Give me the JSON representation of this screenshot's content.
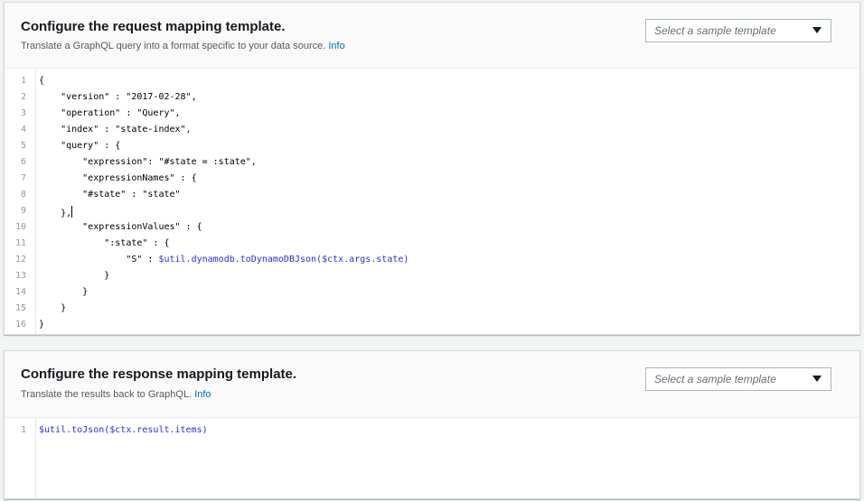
{
  "request": {
    "title": "Configure the request mapping template.",
    "description": "Translate a GraphQL query into a format specific to your data source.",
    "info_label": "Info",
    "select_placeholder": "Select a sample template",
    "lines": [
      {
        "n": "1",
        "text": "{"
      },
      {
        "n": "2",
        "text": "    \"version\" : \"2017-02-28\","
      },
      {
        "n": "3",
        "text": "    \"operation\" : \"Query\","
      },
      {
        "n": "4",
        "text": "    \"index\" : \"state-index\","
      },
      {
        "n": "5",
        "text": "    \"query\" : {"
      },
      {
        "n": "6",
        "text": "        \"expression\": \"#state = :state\","
      },
      {
        "n": "7",
        "text": "        \"expressionNames\" : {"
      },
      {
        "n": "8",
        "text": "        \"#state\" : \"state\""
      },
      {
        "n": "9",
        "text": "    },"
      },
      {
        "n": "10",
        "text": "        \"expressionValues\" : {"
      },
      {
        "n": "11",
        "text": "            \":state\" : {"
      },
      {
        "n": "12",
        "text": "                \"S\" : $util.dynamodb.toDynamoDBJson($ctx.args.state)"
      },
      {
        "n": "13",
        "text": "            }"
      },
      {
        "n": "14",
        "text": "        }"
      },
      {
        "n": "15",
        "text": "    }"
      },
      {
        "n": "16",
        "text": "}"
      }
    ]
  },
  "response": {
    "title": "Configure the response mapping template.",
    "description": "Translate the results back to GraphQL.",
    "info_label": "Info",
    "select_placeholder": "Select a sample template",
    "lines": [
      {
        "n": "1",
        "text": "$util.toJson($ctx.result.items)"
      }
    ]
  }
}
